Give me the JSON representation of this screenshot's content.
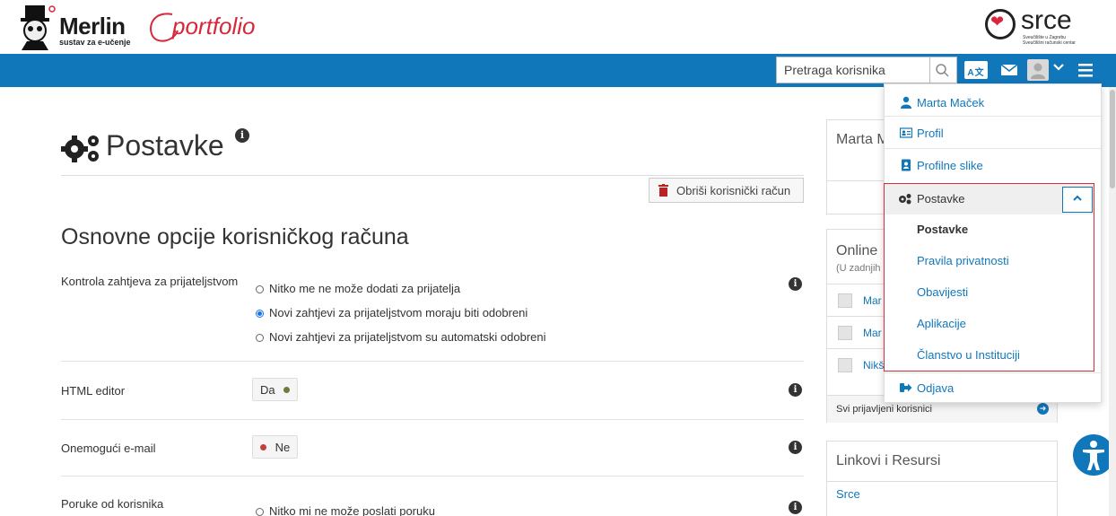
{
  "header": {
    "merlin_title": "Merlin",
    "merlin_subtitle": "sustav za e-učenje",
    "portfolio_title": "portfolio",
    "srce_title": "srce",
    "srce_sub1": "Sveučilište u Zagrebu",
    "srce_sub2": "Sveučilišni računski centar"
  },
  "navbar": {
    "search_placeholder": "Pretraga korisnika",
    "lang_label": "A文",
    "colors": {
      "bar": "#1177bb"
    }
  },
  "page": {
    "title": "Postavke",
    "delete_button": "Obriši korisnički račun",
    "section_heading": "Osnovne opcije korisničkog računa"
  },
  "settings": {
    "friend_control": {
      "label": "Kontrola zahtjeva za prijateljstvom",
      "options": [
        "Nitko me ne može dodati za prijatelja",
        "Novi zahtjevi za prijateljstvom moraju biti odobreni",
        "Novi zahtjevi za prijateljstvom su automatski odobreni"
      ],
      "selected_index": 1
    },
    "html_editor": {
      "label": "HTML editor",
      "value": "Da"
    },
    "disable_email": {
      "label": "Onemogući e-mail",
      "value": "Ne"
    },
    "user_messages": {
      "label": "Poruke od korisnika",
      "options": [
        "Nitko mi ne može poslati poruku"
      ]
    }
  },
  "sidebar": {
    "panel1_head": "Marta M",
    "online": {
      "head": "Online",
      "sub": "(U zadnjih",
      "users": [
        "Mar",
        "Mar",
        "Nikš"
      ],
      "footer": "Svi prijavljeni korisnici"
    },
    "links": {
      "head": "Linkovi i Resursi",
      "items": [
        "Srce"
      ]
    }
  },
  "user_menu": {
    "user_name": "Marta Maček",
    "profile": "Profil",
    "profile_pictures": "Profilne slike",
    "settings_head": "Postavke",
    "settings_items": [
      "Postavke",
      "Pravila privatnosti",
      "Obavijesti",
      "Aplikacije",
      "Članstvo u Instituciji"
    ],
    "logout": "Odjava"
  }
}
